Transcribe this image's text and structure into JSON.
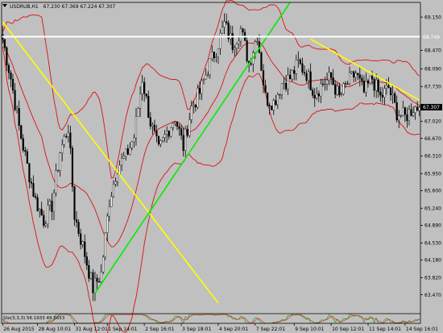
{
  "chart_data": {
    "type": "candlestick",
    "symbol_label": "USDRUB,H1",
    "ohlc_label": "67.230 67.369 67.224 67.307",
    "current_price": "67.307",
    "hline_label": "68.749",
    "ylim": [
      63.1,
      69.45
    ],
    "y_ticks": [
      "69.150",
      "68.470",
      "68.090",
      "67.730",
      "67.020",
      "66.670",
      "66.310",
      "65.950",
      "65.600",
      "65.240",
      "64.890",
      "64.530",
      "64.180",
      "63.820",
      "63.470"
    ],
    "y_tick_values": [
      69.15,
      68.47,
      68.09,
      67.73,
      67.02,
      66.67,
      66.31,
      65.95,
      65.6,
      65.24,
      64.89,
      64.53,
      64.18,
      63.82,
      63.47
    ],
    "x_ticks": [
      "26 Aug 2015",
      "28 Aug 10:01",
      "31 Aug 12:01",
      "1 Sep 14:01",
      "2 Sep 16:01",
      "3 Sep 18:01",
      "4 Sep 20:01",
      "7 Sep 22:01",
      "9 Sep 10:01",
      "10 Sep 12:01",
      "11 Sep 14:01",
      "14 Sep 16:01"
    ],
    "x_tick_positions": [
      0,
      17,
      35,
      51,
      69,
      87,
      105,
      123,
      142,
      160,
      178,
      196
    ],
    "candle_count": 204,
    "price_path": [
      [
        0,
        68.7
      ],
      [
        4,
        67.9
      ],
      [
        8,
        66.9
      ],
      [
        12,
        66.1
      ],
      [
        16,
        65.4
      ],
      [
        20,
        65.0
      ],
      [
        24,
        65.3
      ],
      [
        28,
        66.4
      ],
      [
        32,
        66.9
      ],
      [
        35,
        65.1
      ],
      [
        40,
        64.3
      ],
      [
        44,
        63.6
      ],
      [
        48,
        63.9
      ],
      [
        52,
        65.4
      ],
      [
        56,
        66.1
      ],
      [
        60,
        66.3
      ],
      [
        64,
        66.7
      ],
      [
        68,
        67.9
      ],
      [
        72,
        67.0
      ],
      [
        76,
        66.4
      ],
      [
        80,
        66.8
      ],
      [
        84,
        67.1
      ],
      [
        88,
        66.5
      ],
      [
        92,
        67.3
      ],
      [
        96,
        67.6
      ],
      [
        100,
        68.1
      ],
      [
        104,
        68.5
      ],
      [
        108,
        69.0
      ],
      [
        112,
        68.6
      ],
      [
        116,
        68.9
      ],
      [
        120,
        68.2
      ],
      [
        124,
        68.8
      ],
      [
        128,
        67.5
      ],
      [
        132,
        67.4
      ],
      [
        136,
        67.8
      ],
      [
        140,
        67.9
      ],
      [
        144,
        68.2
      ],
      [
        148,
        68.0
      ],
      [
        152,
        67.6
      ],
      [
        156,
        67.8
      ],
      [
        160,
        67.9
      ],
      [
        164,
        67.5
      ],
      [
        168,
        67.8
      ],
      [
        172,
        68.0
      ],
      [
        176,
        67.6
      ],
      [
        180,
        67.9
      ],
      [
        184,
        67.5
      ],
      [
        188,
        67.7
      ],
      [
        192,
        67.2
      ],
      [
        196,
        67.1
      ],
      [
        200,
        67.3
      ],
      [
        203,
        67.3
      ]
    ],
    "bands_period": 20,
    "bands_deviation": 2,
    "oscillator_label": "Sto(3,3,3) 56.1933 49.5653",
    "trendlines": [
      {
        "color": "#ffff00",
        "x": [
          0,
          105
        ],
        "y": [
          69.05,
          63.3
        ]
      },
      {
        "color": "#00ee00",
        "x": [
          45,
          140
        ],
        "y": [
          63.5,
          69.45
        ]
      },
      {
        "color": "#ffff00",
        "x": [
          150,
          203
        ],
        "y": [
          68.7,
          67.45
        ]
      }
    ],
    "hline_value": 68.749,
    "colors": {
      "background": "#c0c0c0",
      "candle_up": "#000000",
      "candle_down": "#000000",
      "bands": "#dd1111",
      "hline": "#ffffff",
      "price_label_bg": "#000000",
      "price_label_fg": "#ffffff"
    }
  }
}
